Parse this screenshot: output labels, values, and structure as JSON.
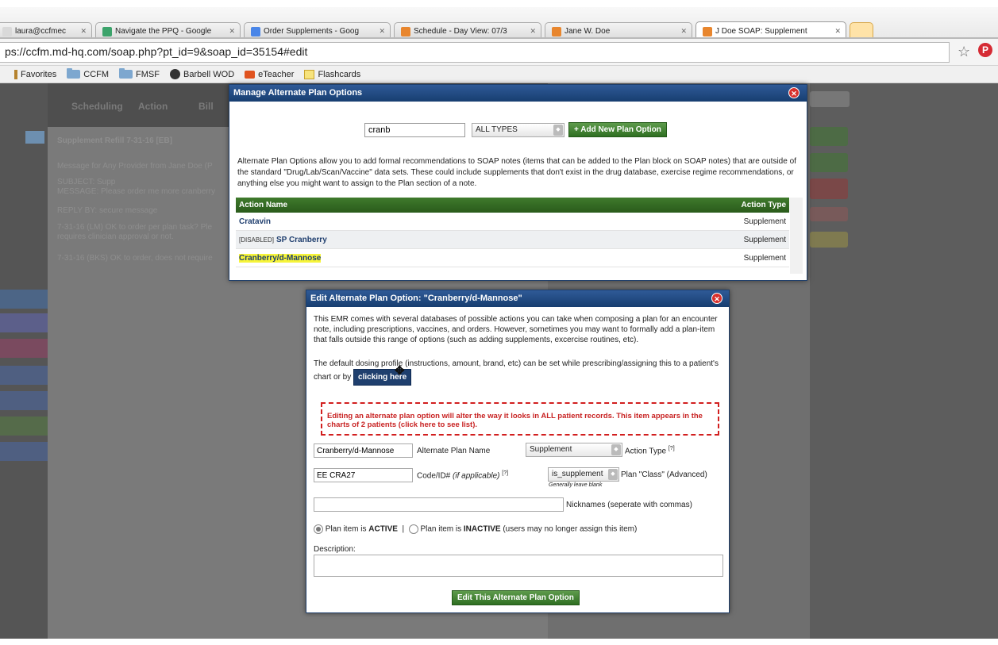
{
  "browser": {
    "tabs": [
      {
        "title": "laura@ccfmec",
        "color": "#d9d9d9"
      },
      {
        "title": "Navigate the PPQ - Google",
        "color": "#3ca36b"
      },
      {
        "title": "Order Supplements - Goog",
        "color": "#4a86e8"
      },
      {
        "title": "Schedule - Day View: 07/3",
        "color": "#e8862e"
      },
      {
        "title": "Jane W. Doe",
        "color": "#e8862e"
      },
      {
        "title": "J Doe SOAP: Supplement",
        "color": "#e8862e"
      }
    ],
    "url": "ps://ccfm.md-hq.com/soap.php?pt_id=9&soap_id=35154#edit",
    "bookmarks": [
      "Favorites",
      "CCFM",
      "FMSF",
      "Barbell WOD",
      "eTeacher",
      "Flashcards"
    ]
  },
  "background": {
    "nav": [
      "Scheduling",
      "Action",
      "Bill"
    ],
    "lines": [
      "Supplement Refill 7-31-16  [EB]",
      "Message for Any Provider from Jane Doe (P",
      "SUBJECT: Supp",
      "MESSAGE: Please order me more cranberry",
      "REPLY BY: secure message",
      "7-31-16 (LM) OK to order per plan task? Ple",
      "requires clinician approval or not.",
      "7-31-16 (BKS) OK to order, does not require"
    ]
  },
  "manage": {
    "title": "Manage Alternate Plan Options",
    "search_value": "cranb",
    "type_value": "ALL TYPES",
    "add_button": "+ Add New Plan Option",
    "description": "Alternate Plan Options allow you to add formal recommendations to SOAP notes (items that can be added to the Plan block on SOAP notes) that are outside of the standard \"Drug/Lab/Scan/Vaccine\" data sets. These could include supplements that don't exist in the drug database, exercise regime recommendations, or anything else you might want to assign to the Plan section of a note.",
    "col_name": "Action Name",
    "col_type": "Action Type",
    "rows": [
      {
        "prefix": "",
        "name": "Cratavin",
        "type": "Supplement"
      },
      {
        "prefix": "[DISABLED]",
        "name": "SP Cranberry",
        "type": "Supplement"
      },
      {
        "prefix": "",
        "name": "Cranberry/d-Mannose",
        "type": "Supplement"
      }
    ]
  },
  "edit": {
    "title": "Edit Alternate Plan Option: \"Cranberry/d-Mannose\"",
    "intro": "This EMR comes with several databases of possible actions you can take when composing a plan for an encounter note, including prescriptions, vaccines, and orders. However, sometimes you may want to formally add a plan-item that falls outside this range of options (such as adding supplements, excercise routines, etc).",
    "dosing_text": "The default dosing profile (instructions, amount, brand, etc) can be set while prescribing/assigning this to a patient's chart or by",
    "clicking_here": "clicking here",
    "warning": "Editing an alternate plan option will alter the way it looks in ALL patient records. This item appears in the charts of 2 patients (click here to see list).",
    "plan_name_value": "Cranberry/d-Mannose",
    "plan_name_label": "Alternate Plan Name",
    "action_type_value": "Supplement",
    "action_type_label": "Action Type",
    "help_mark": "[?]",
    "code_value": "EE CRA27",
    "code_label": "Code/ID#",
    "code_label_hint": "(if applicable)",
    "class_value": "is_supplement",
    "class_hint": "Generally leave blank",
    "class_label": "Plan \"Class\" (Advanced)",
    "nicknames_value": "",
    "nicknames_label": "Nicknames (seperate with commas)",
    "active_label_pre": "Plan item is ",
    "active_label_bold": "ACTIVE",
    "separator": "|",
    "inactive_label_pre": "Plan item is ",
    "inactive_label_bold": "INACTIVE",
    "inactive_label_post": " (users may no longer assign this item)",
    "description_label": "Description:",
    "submit": "Edit This Alternate Plan Option"
  }
}
